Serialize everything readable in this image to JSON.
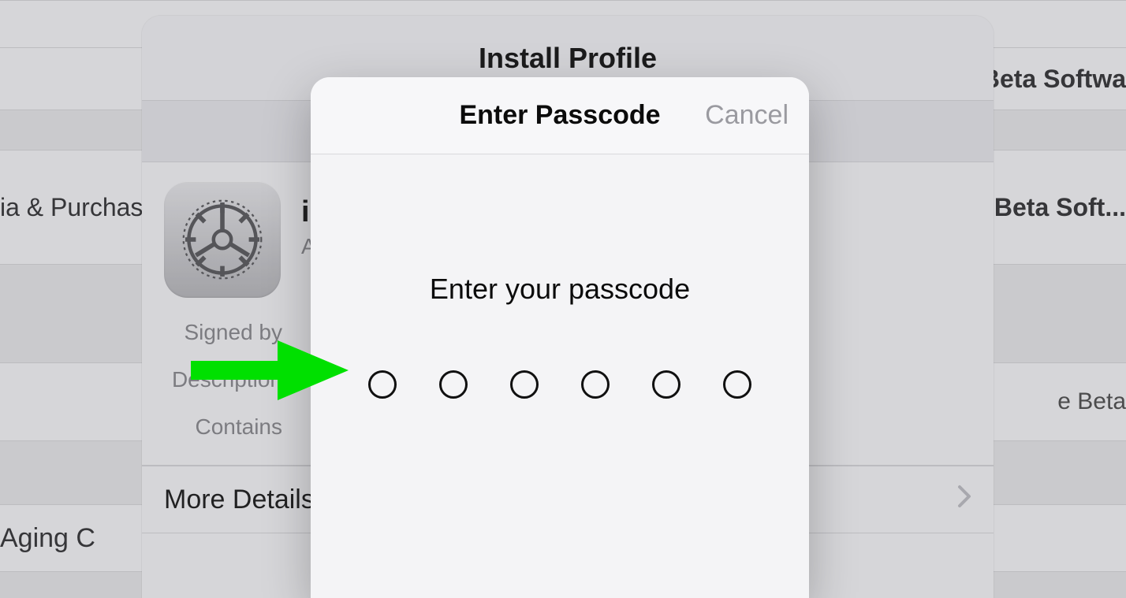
{
  "background": {
    "row_purchases": "ia & Purchases",
    "row_aging": "Aging C",
    "row_beta_top": "Beta Softwa",
    "row_beta_mid": "Beta Soft...",
    "row_beta_desc": "e Beta"
  },
  "sheet": {
    "title": "Install Profile",
    "profile_name_visible": "iO",
    "profile_sub_visible": "A",
    "labels": {
      "signed_by": "Signed by",
      "description": "Description",
      "contains": "Contains"
    },
    "more_details": "More Details"
  },
  "modal": {
    "title": "Enter Passcode",
    "cancel": "Cancel",
    "prompt": "Enter your passcode",
    "digits": 6
  },
  "annotation": {
    "arrow_color": "#00e000"
  }
}
